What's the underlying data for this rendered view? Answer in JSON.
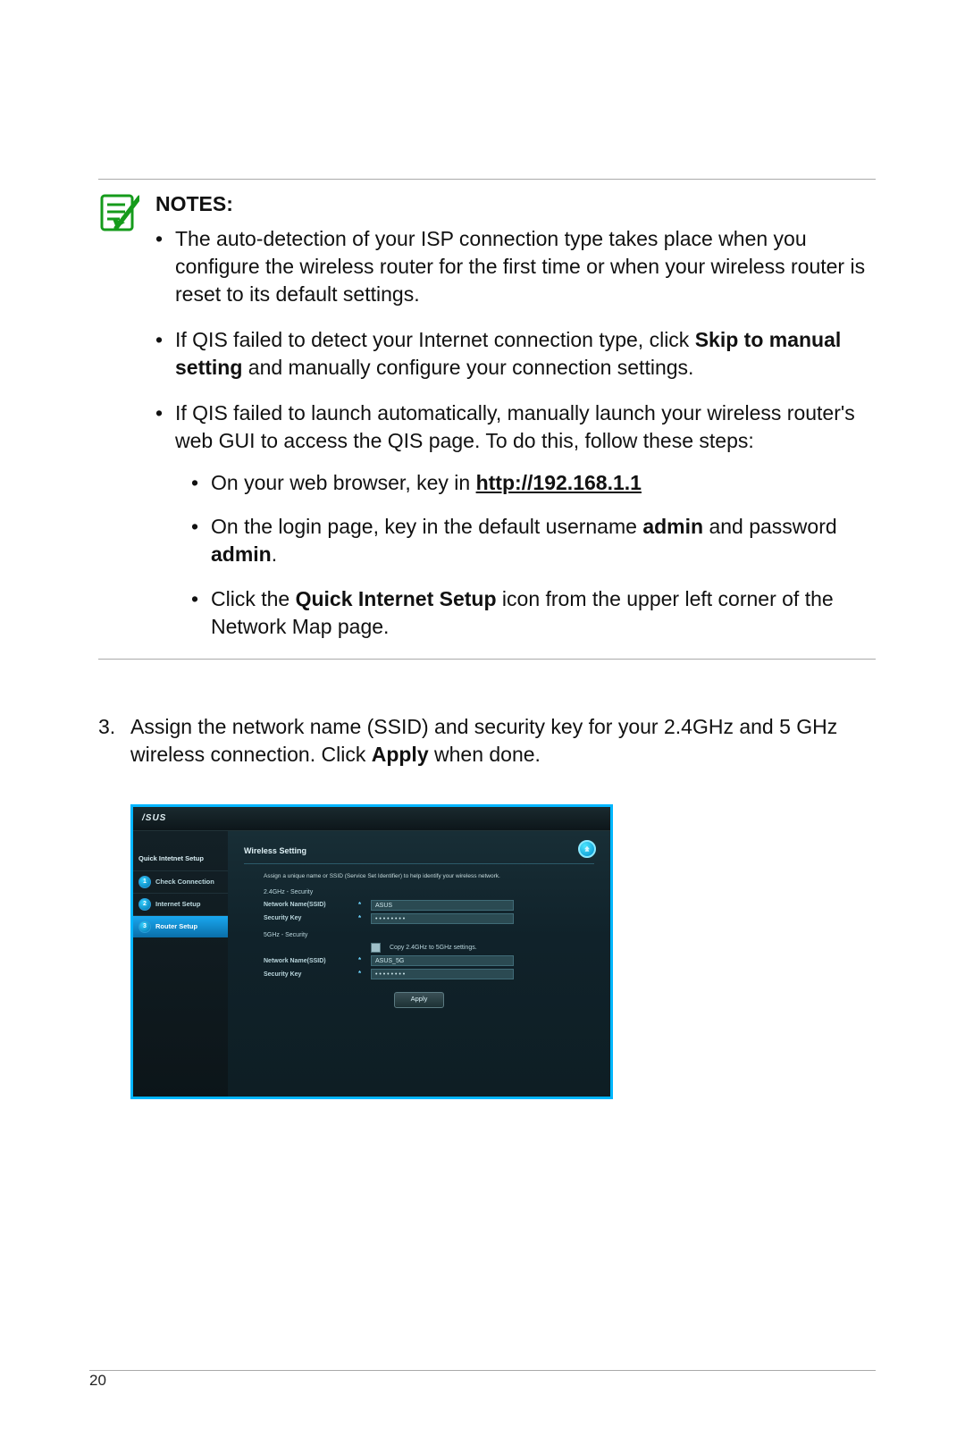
{
  "notesHeading": "NOTES",
  "notes": {
    "bullet1": "The auto-detection of your ISP connection type takes place when you configure the wireless router for the first time or when your wireless router is reset to its default settings.",
    "bullet2_pre": "If QIS failed to detect your Internet connection type, click ",
    "bullet2_bold": "Skip to manual setting",
    "bullet2_post": " and manually configure your connection settings.",
    "bullet3_intro": "If QIS failed to launch automatically, manually launch your wireless router's web GUI to access the QIS page. To do this, follow these steps:",
    "sub1_pre": "On your web browser, key in ",
    "sub1_url": "http://192.168.1.1",
    "sub2_a": "On the login page, key in the default username ",
    "sub2_b": "admin",
    "sub2_c": " and password ",
    "sub2_d": "admin",
    "sub2_e": ".",
    "sub3_a": "Click the ",
    "sub3_b": "Quick Internet Setup",
    "sub3_c": " icon from the upper left corner of the Network Map page."
  },
  "step3": {
    "num": "3.",
    "text_a": "Assign the network name (SSID) and security key for your 2.4GHz and 5 GHz wireless connection. Click ",
    "text_b": "Apply",
    "text_c": " when done."
  },
  "screenshot": {
    "brand": "/SUS",
    "sidebarTitle": "Quick Intetnet Setup",
    "sidebar": [
      {
        "n": "1",
        "label": "Check Connection"
      },
      {
        "n": "2",
        "label": "Internet Setup"
      },
      {
        "n": "3",
        "label": "Router Setup"
      }
    ],
    "panelTitle": "Wireless Setting",
    "instruction": "Assign a unique name or SSID (Service Set Identifier) to help identify your wireless network.",
    "section24": "2.4GHz - Security",
    "section5": "5GHz - Security",
    "labelSSID": "Network Name(SSID)",
    "labelKey": "Security Key",
    "ssid24": "ASUS",
    "key24": "• • • • • • • •",
    "copyLabel": "Copy 2.4GHz to 5GHz settings.",
    "ssid5": "ASUS_5G",
    "key5": "• • • • • • • •",
    "apply": "Apply"
  },
  "pageNumber": "20"
}
